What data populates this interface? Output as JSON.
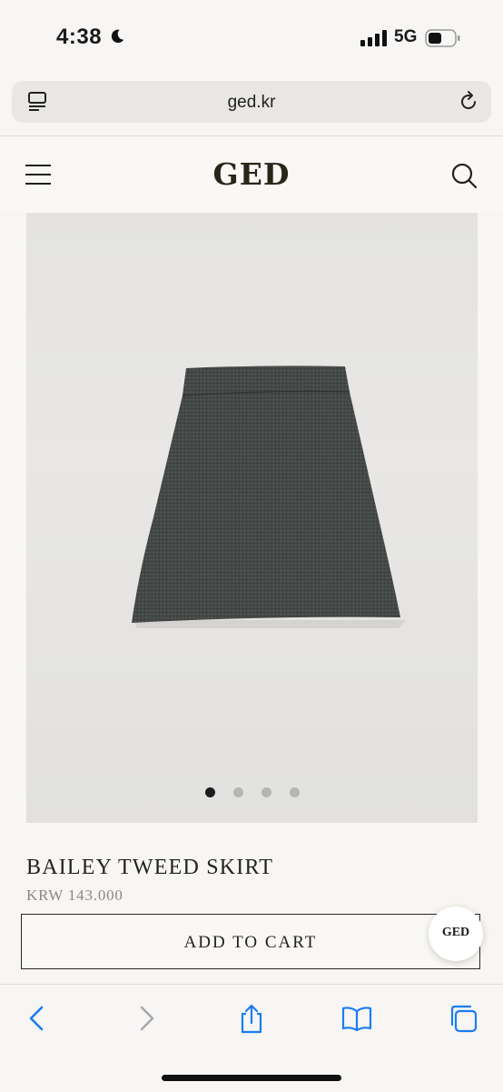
{
  "status_bar": {
    "time": "4:38",
    "network": "5G",
    "moon_icon": "moon-icon",
    "signal_icon": "cellular-signal-icon",
    "battery_icon": "battery-icon"
  },
  "browser": {
    "url": "ged.kr",
    "tabs_icon": "page-menu-icon",
    "reload_icon": "reload-icon"
  },
  "site_header": {
    "logo": "GED",
    "menu_icon": "hamburger-menu-icon",
    "search_icon": "search-icon"
  },
  "gallery": {
    "image": "grey tweed mini skirt",
    "total_slides": 4,
    "active_slide": 1
  },
  "product": {
    "name": "BAILEY TWEED SKIRT",
    "price": "KRW 143.000",
    "cta_label": "ADD TO CART"
  },
  "chat_badge": {
    "label": "GED"
  },
  "toolbar": {
    "icons": [
      "back-icon",
      "forward-icon",
      "share-icon",
      "bookmarks-icon",
      "tabs-icon"
    ]
  },
  "colors": {
    "background": "#f8f6f2",
    "logo": "#2b2519",
    "accent_blue": "#1a7cf5",
    "disabled": "#a8a8ad"
  }
}
